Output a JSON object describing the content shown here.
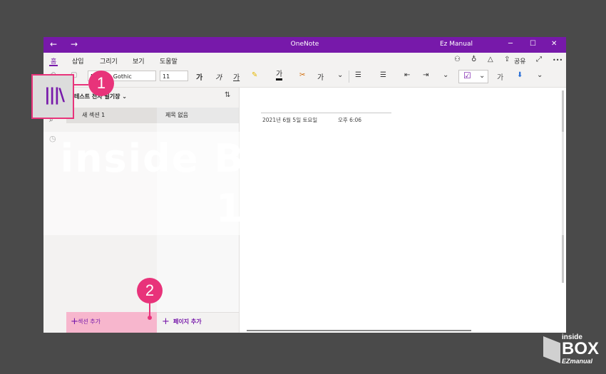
{
  "window": {
    "title": "OneNote",
    "user": "Ez Manual",
    "back_icon": "←",
    "forward_icon": "→",
    "minimize_icon": "─",
    "maximize_icon": "☐",
    "close_icon": "✕"
  },
  "menu": {
    "tabs": [
      "홈",
      "삽입",
      "그리기",
      "보기",
      "도움말"
    ],
    "active": "홈",
    "share_label": "공유",
    "more_icon": "•••"
  },
  "ribbon": {
    "font_name": "Malgun Gothic",
    "font_size": "11",
    "bold": "가",
    "italic": "가",
    "underline": "가",
    "highlight": "✎",
    "font_color": "가",
    "clear": "가",
    "chevron": "⌄",
    "bullets": "☰",
    "numbering": "☰",
    "outdent": "⇤",
    "indent": "⇥",
    "todo_check": "☑",
    "styles": "가"
  },
  "notebook": {
    "name": "테스트 전자 필기장",
    "section": "새 섹션 1",
    "page": "제목 없음",
    "add_section": "섹션 추가",
    "add_page": "페이지 추가",
    "plus": "+"
  },
  "page_content": {
    "date": "2021년 6월 5일 토요일",
    "time": "오후 6:06"
  },
  "annotations": {
    "callout1": "1",
    "callout2": "2"
  },
  "watermark": {
    "line1": "inside BOX EZmanual",
    "line2": "140438"
  },
  "logo": {
    "line1": "inside",
    "line2": "BOX",
    "line3": "EZmanual"
  },
  "colors": {
    "accent": "#7719aa",
    "callout": "#e8337a",
    "highlight_section": "#f7b6cd"
  }
}
